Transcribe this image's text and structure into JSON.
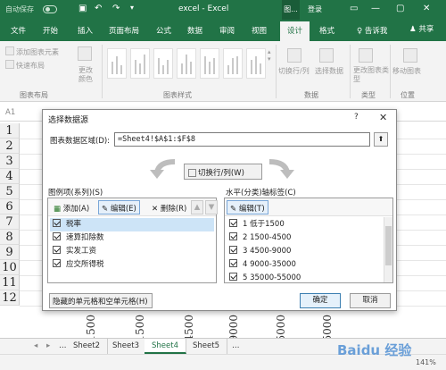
{
  "app": {
    "title": "excel - Excel",
    "autosave_label": "自动保存",
    "autosave_state": "关",
    "context_tool": "图...",
    "login": "登录"
  },
  "ribbon_tabs": [
    "文件",
    "开始",
    "插入",
    "页面布局",
    "公式",
    "数据",
    "审阅",
    "视图",
    "设计",
    "格式"
  ],
  "ribbon_tell": "♀ 告诉我",
  "ribbon_share": "♟ 共享",
  "ribbon": {
    "add_element": "添加图表元素",
    "quick_layout": "快速布局",
    "change_colors": "更改颜色",
    "switch_rowcol": "切换行/列",
    "select_data": "选择数据",
    "change_type": "更改图表类型",
    "move_chart": "移动图表",
    "groups": {
      "layouts": "图表布局",
      "styles": "图表样式",
      "data": "数据",
      "type": "类型",
      "location": "位置"
    }
  },
  "name_box": "A1",
  "row_numbers": [
    "1",
    "2",
    "3",
    "4",
    "5",
    "6",
    "7",
    "8",
    "9",
    "10",
    "11",
    "12"
  ],
  "dialog": {
    "title": "选择数据源",
    "help": "?",
    "close": "✕",
    "range_label": "图表数据区域(D):",
    "range_value": "=Sheet4!$A$1:$F$8",
    "switch_label": "切换行/列(W)",
    "legend_title": "图例项(系列)(S)",
    "axis_title": "水平(分类)轴标签(C)",
    "legend_toolbar": {
      "add": "添加(A)",
      "edit": "编辑(E)",
      "delete": "删除(R)",
      "up": "▲",
      "down": "▼"
    },
    "axis_toolbar": {
      "edit": "编辑(T)"
    },
    "series": [
      "税率",
      "速算扣除数",
      "实发工资",
      "应交所得税"
    ],
    "categories": [
      "1 低于1500",
      "2 1500-4500",
      "3 4500-9000",
      "4 9000-35000",
      "5 35000-55000"
    ],
    "hidden_cells": "隐藏的单元格和空单元格(H)",
    "ok": "确定",
    "cancel": "取消"
  },
  "vertical_texts": [
    "1500",
    "1500",
    "4500",
    "9000",
    "35000",
    "55000"
  ],
  "sheets": [
    "Sheet2",
    "Sheet3",
    "Sheet4",
    "Sheet5"
  ],
  "active_sheet": "Sheet4",
  "zoom": "141%",
  "watermark": "Baidu 经验"
}
